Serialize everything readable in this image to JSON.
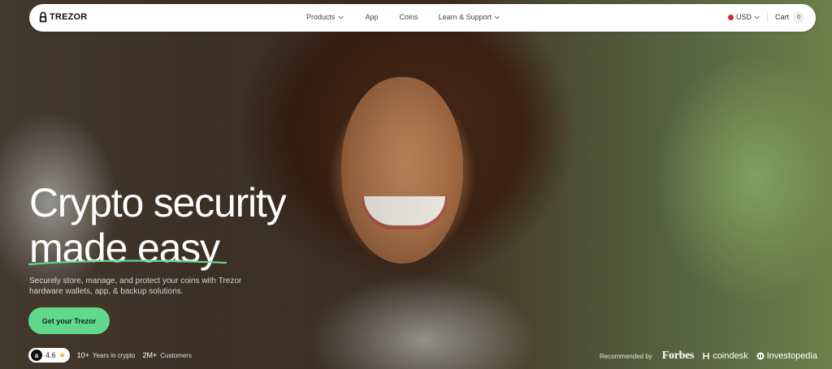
{
  "brand": {
    "name": "TREZOR"
  },
  "nav": {
    "links": [
      {
        "label": "Products",
        "dropdown": true
      },
      {
        "label": "App",
        "dropdown": false
      },
      {
        "label": "Coins",
        "dropdown": false
      },
      {
        "label": "Learn & Support",
        "dropdown": true
      }
    ],
    "currency": "USD",
    "cart_label": "Cart",
    "cart_count": "0"
  },
  "hero": {
    "headline_line1": "Crypto security",
    "headline_line2": "made easy",
    "subtext": "Securely store, manage, and protect your coins with Trezor hardware wallets, app, & backup solutions.",
    "cta_label": "Get your Trezor"
  },
  "stats": {
    "rating": "4.6",
    "years_value": "10+",
    "years_label": "Years in crypto",
    "customers_value": "2M+",
    "customers_label": "Customers"
  },
  "press": {
    "label": "Recommended by",
    "outlets": [
      "Forbes",
      "coindesk",
      "Investopedia"
    ]
  },
  "colors": {
    "accent": "#62d88c",
    "nav_bg": "#ffffff",
    "flag_red": "#d9262c",
    "star": "#f0a321"
  },
  "icons": {
    "logo": "padlock-icon",
    "rating": "amazon-icon",
    "star": "star-icon"
  }
}
